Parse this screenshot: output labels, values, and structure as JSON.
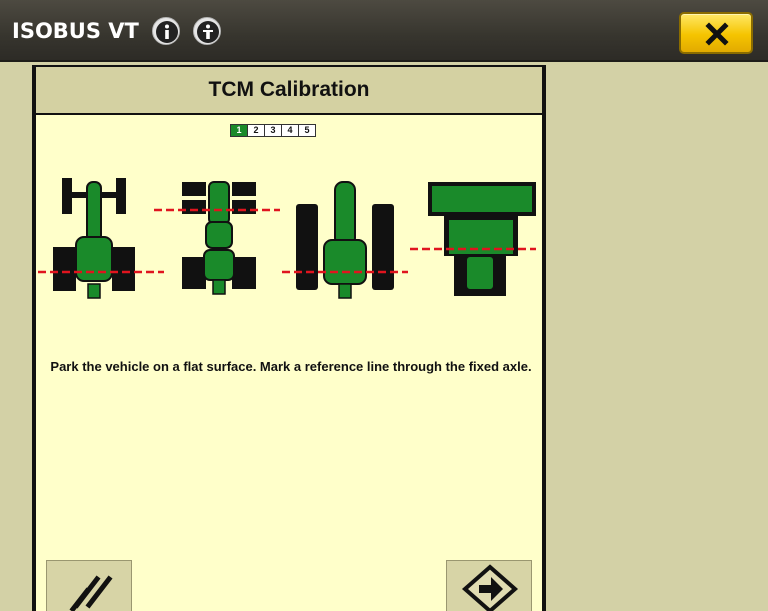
{
  "app": {
    "title": "ISOBUS VT",
    "icons": [
      "info-icon",
      "info-icon-2",
      "close-icon"
    ]
  },
  "panel": {
    "title": "TCM Calibration",
    "steps": [
      {
        "label": "1",
        "active": true
      },
      {
        "label": "2",
        "active": false
      },
      {
        "label": "3",
        "active": false
      },
      {
        "label": "4",
        "active": false
      },
      {
        "label": "5",
        "active": false
      }
    ],
    "vehicles": [
      "mfwd-tractor-icon",
      "articulated-4wd-tractor-icon",
      "tracked-tractor-icon",
      "self-propelled-sprayer-icon"
    ],
    "instruction": "Park the vehicle on a flat surface.  Mark a reference line through the fixed axle.",
    "buttons": {
      "reset_icon": "double-slash-icon",
      "next_icon": "arrow-right-icon"
    }
  },
  "colors": {
    "titlebar": "#37352e",
    "background": "#d3d1a6",
    "panel": "#ffffca",
    "accent_green": "#1a8a2a",
    "reference_line": "#e0141e",
    "close_yellow": "#f5c400"
  }
}
